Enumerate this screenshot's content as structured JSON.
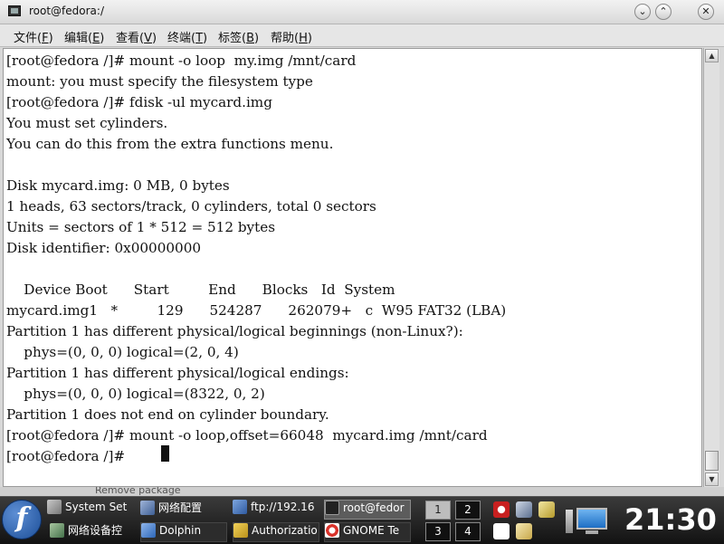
{
  "window": {
    "title": "root@fedora:/"
  },
  "menu": [
    {
      "label": "文件(",
      "key": "F",
      "end": ")"
    },
    {
      "label": "编辑(",
      "key": "E",
      "end": ")"
    },
    {
      "label": "查看(",
      "key": "V",
      "end": ")"
    },
    {
      "label": "终端(",
      "key": "T",
      "end": ")"
    },
    {
      "label": "标签(",
      "key": "B",
      "end": ")"
    },
    {
      "label": "帮助(",
      "key": "H",
      "end": ")"
    }
  ],
  "terminal": {
    "lines": [
      "[root@fedora /]# mount -o loop  my.img /mnt/card",
      "mount: you must specify the filesystem type",
      "[root@fedora /]# fdisk -ul mycard.img",
      "You must set cylinders.",
      "You can do this from the extra functions menu.",
      "",
      "Disk mycard.img: 0 MB, 0 bytes",
      "1 heads, 63 sectors/track, 0 cylinders, total 0 sectors",
      "Units = sectors of 1 * 512 = 512 bytes",
      "Disk identifier: 0x00000000",
      "",
      "    Device Boot      Start         End      Blocks   Id  System",
      "mycard.img1   *         129      524287      262079+   c  W95 FAT32 (LBA)",
      "Partition 1 has different physical/logical beginnings (non-Linux?):",
      "    phys=(0, 0, 0) logical=(2, 0, 4)",
      "Partition 1 has different physical/logical endings:",
      "    phys=(0, 0, 0) logical=(8322, 0, 2)",
      "Partition 1 does not end on cylinder boundary.",
      "[root@fedora /]# mount -o loop,offset=66048  mycard.img /mnt/card",
      "[root@fedora /]#"
    ]
  },
  "behind_window_text": "Remove package",
  "taskbar": {
    "tasks": [
      {
        "label": "System Set",
        "icon": "tools-icon"
      },
      {
        "label": "网络配置",
        "icon": "network-config-icon"
      },
      {
        "label": "ftp://192.16",
        "icon": "ftp-icon"
      },
      {
        "label": "root@fedor",
        "icon": "terminal-icon"
      },
      {
        "label": "网络设备控",
        "icon": "network-device-icon"
      },
      {
        "label": "Dolphin",
        "icon": "dolphin-icon"
      },
      {
        "label": "Authorizatio",
        "icon": "lock-icon"
      },
      {
        "label": "GNOME Te",
        "icon": "lifebuoy-icon"
      }
    ],
    "pager": [
      "1",
      "2",
      "3",
      "4"
    ],
    "clock": "21:30"
  },
  "colors": {
    "panel": "#1e1e1e",
    "terminal_bg": "#ffffff",
    "terminal_fg": "#111111",
    "active_task": "#5c5c5c"
  }
}
